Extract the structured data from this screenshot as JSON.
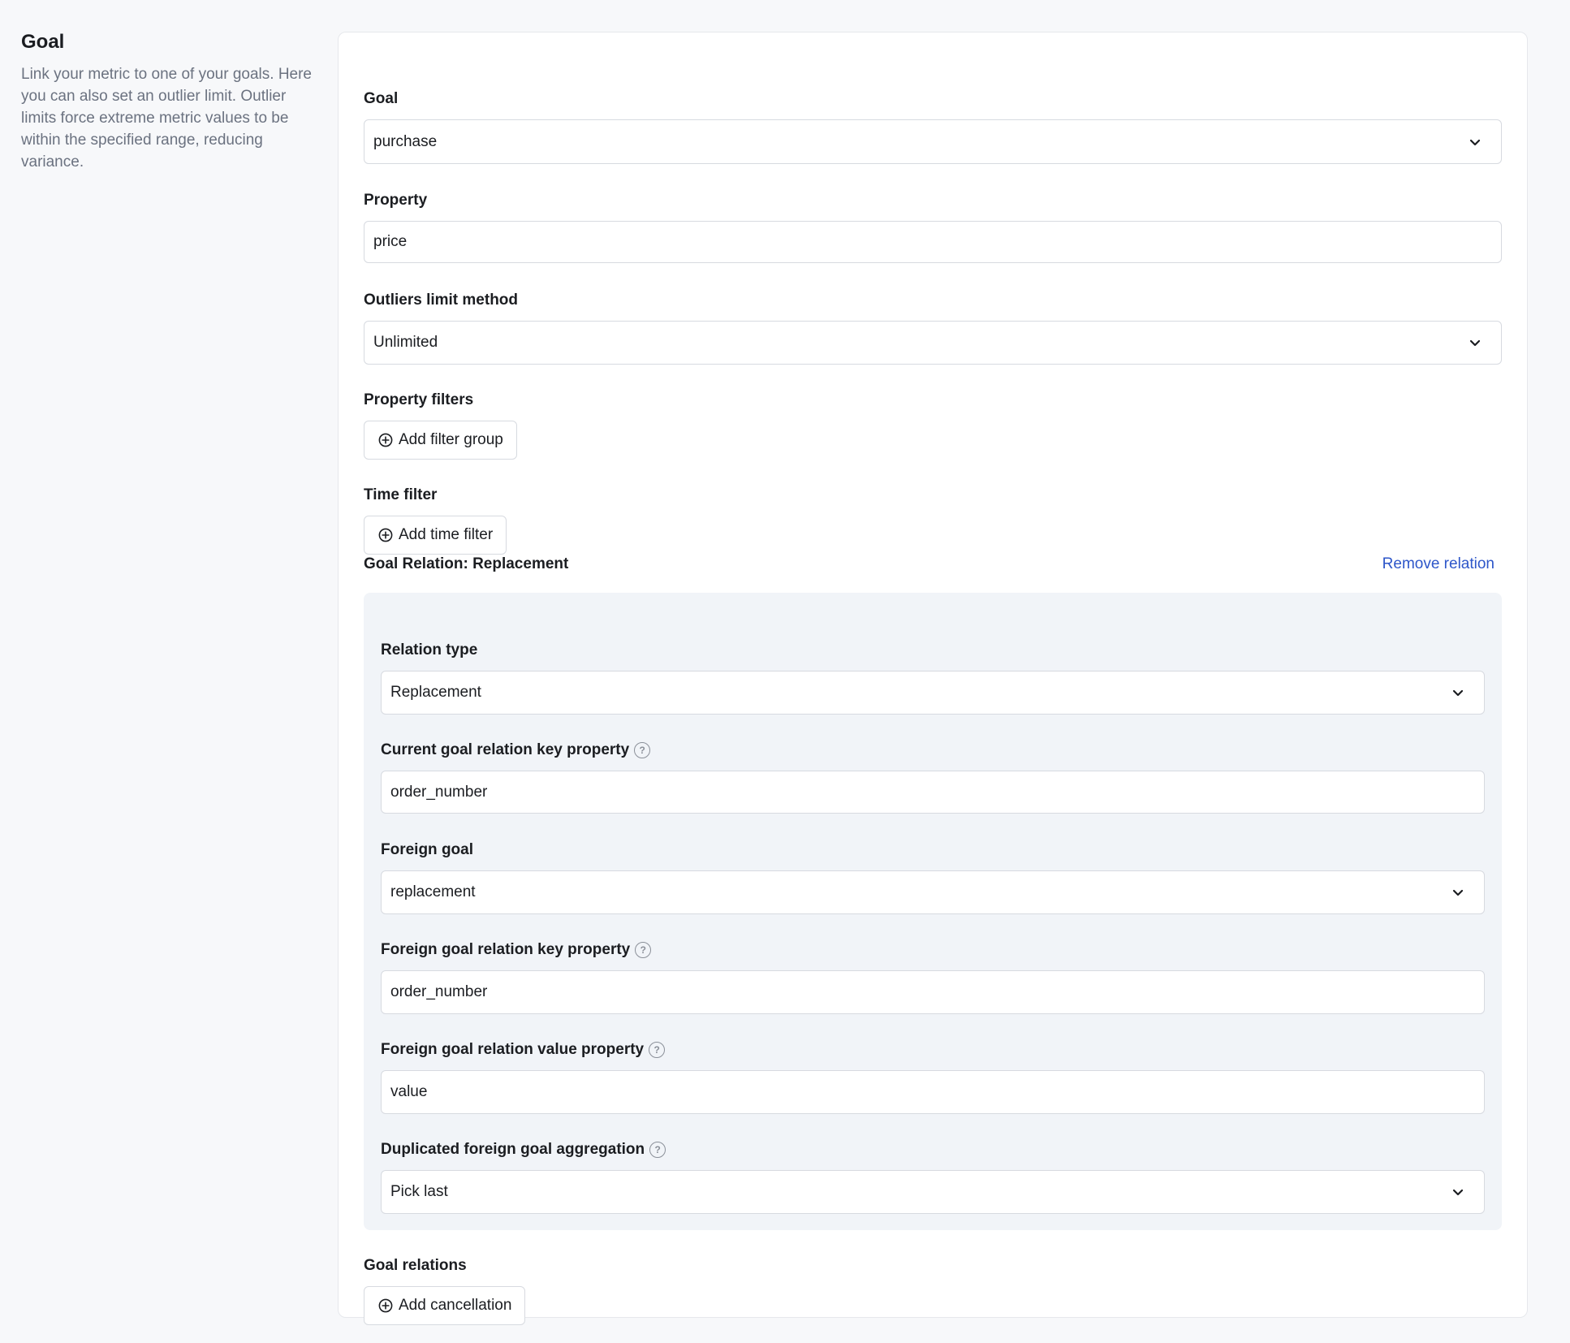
{
  "sidebar": {
    "title": "Goal",
    "description": "Link your metric to one of your goals. Here you can also set an outlier limit. Outlier limits force extreme metric values to be within the specified range, reducing variance."
  },
  "form": {
    "goal": {
      "label": "Goal",
      "value": "purchase"
    },
    "property": {
      "label": "Property",
      "value": "price"
    },
    "outliers": {
      "label": "Outliers limit method",
      "value": "Unlimited"
    },
    "property_filters": {
      "label": "Property filters",
      "button": "Add filter group"
    },
    "time_filter": {
      "label": "Time filter",
      "button": "Add time filter"
    },
    "relation": {
      "title": "Goal Relation: Replacement",
      "remove_label": "Remove relation",
      "relation_type": {
        "label": "Relation type",
        "value": "Replacement"
      },
      "current_key": {
        "label": "Current goal relation key property",
        "value": "order_number"
      },
      "foreign_goal": {
        "label": "Foreign goal",
        "value": "replacement"
      },
      "foreign_key": {
        "label": "Foreign goal relation key property",
        "value": "order_number"
      },
      "foreign_value": {
        "label": "Foreign goal relation value property",
        "value": "value"
      },
      "aggregation": {
        "label": "Duplicated foreign goal aggregation",
        "value": "Pick last"
      }
    },
    "goal_relations": {
      "label": "Goal relations",
      "button": "Add cancellation"
    }
  },
  "icons": {
    "help": "?"
  }
}
